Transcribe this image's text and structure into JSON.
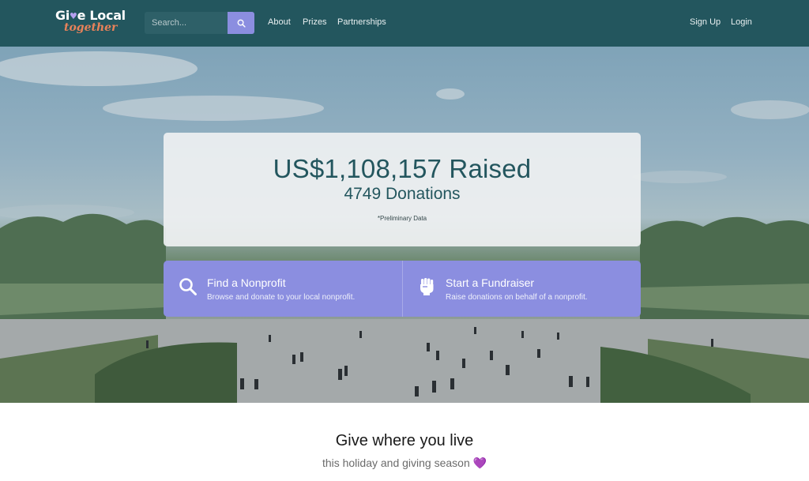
{
  "header": {
    "logo_top_left": "Gi",
    "logo_top_heart": "♥",
    "logo_top_right": "e Local",
    "logo_bottom": "together",
    "search_placeholder": "Search...",
    "nav": {
      "about": "About",
      "prizes": "Prizes",
      "partnerships": "Partnerships"
    },
    "sign_up": "Sign Up",
    "login": "Login"
  },
  "hero": {
    "raised": "US$1,108,157 Raised",
    "donations": "4749 Donations",
    "note": "*Preliminary Data"
  },
  "actions": {
    "find": {
      "title": "Find a Nonprofit",
      "subtitle": "Browse and donate to your local nonprofit.",
      "icon": "search-icon"
    },
    "start": {
      "title": "Start a Fundraiser",
      "subtitle": "Raise donations on behalf of a nonprofit.",
      "icon": "raised-fist-icon"
    }
  },
  "section": {
    "title": "Give where you live",
    "subtitle": "this holiday and giving season",
    "emoji": "💜"
  },
  "colors": {
    "header_bg": "#23565e",
    "accent": "#8b8ee0",
    "logo_orange": "#e8825a"
  }
}
